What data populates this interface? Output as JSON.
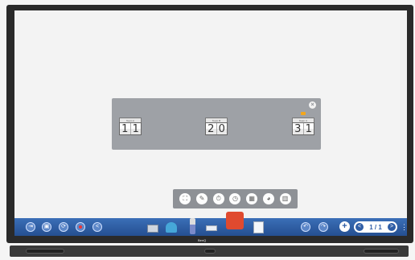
{
  "scoreboard": {
    "teams": [
      {
        "name": "Team A",
        "digits": [
          "1",
          "1"
        ]
      },
      {
        "name": "Team B",
        "digits": [
          "2",
          "0"
        ]
      },
      {
        "name": "Team C",
        "digits": [
          "3",
          "1"
        ]
      }
    ],
    "close_label": "×"
  },
  "palette": {
    "icons": [
      "layout-icon",
      "pen-icon",
      "stopwatch-icon",
      "timer-icon",
      "scoreboard-icon",
      "roulette-icon",
      "calculator-icon"
    ],
    "glyphs": [
      "⛶",
      "✎",
      "⏱",
      "◷",
      "▦",
      "◕",
      "▥"
    ]
  },
  "taskbar": {
    "left_icons": [
      "exit-icon",
      "save-icon",
      "share-icon",
      "record-icon",
      "share-screen-icon"
    ],
    "left_glyphs": [
      "⇥",
      "▣",
      "⟳",
      "",
      "<"
    ],
    "undo": "↶",
    "redo": "↷",
    "add": "+",
    "prev": "<",
    "next": ">",
    "page": "1 / 1",
    "more": "⋮"
  },
  "brand": "BenQ"
}
